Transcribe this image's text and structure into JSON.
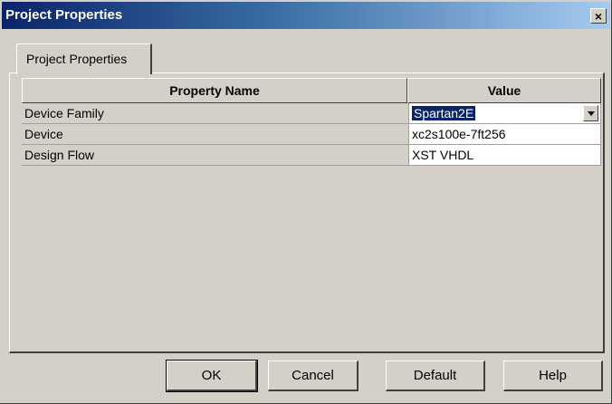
{
  "window": {
    "title": "Project Properties",
    "close_glyph": "×"
  },
  "tabs": [
    {
      "label": "Project Properties",
      "active": true
    }
  ],
  "table": {
    "columns": [
      "Property Name",
      "Value"
    ],
    "rows": [
      {
        "name": "Device Family",
        "value": "Spartan2E",
        "editor": "dropdown",
        "selected": true
      },
      {
        "name": "Device",
        "value": "xc2s100e-7ft256"
      },
      {
        "name": "Design Flow",
        "value": "XST VHDL"
      }
    ]
  },
  "buttons": {
    "ok": "OK",
    "cancel": "Cancel",
    "default": "Default",
    "help": "Help"
  },
  "colors": {
    "title_gradient_start": "#0a246a",
    "title_gradient_end": "#a6caf0",
    "dialog_face": "#d4d0c8",
    "selection": "#0a246a"
  },
  "icons": {
    "close": "close-icon",
    "dropdown": "chevron-down-icon"
  }
}
